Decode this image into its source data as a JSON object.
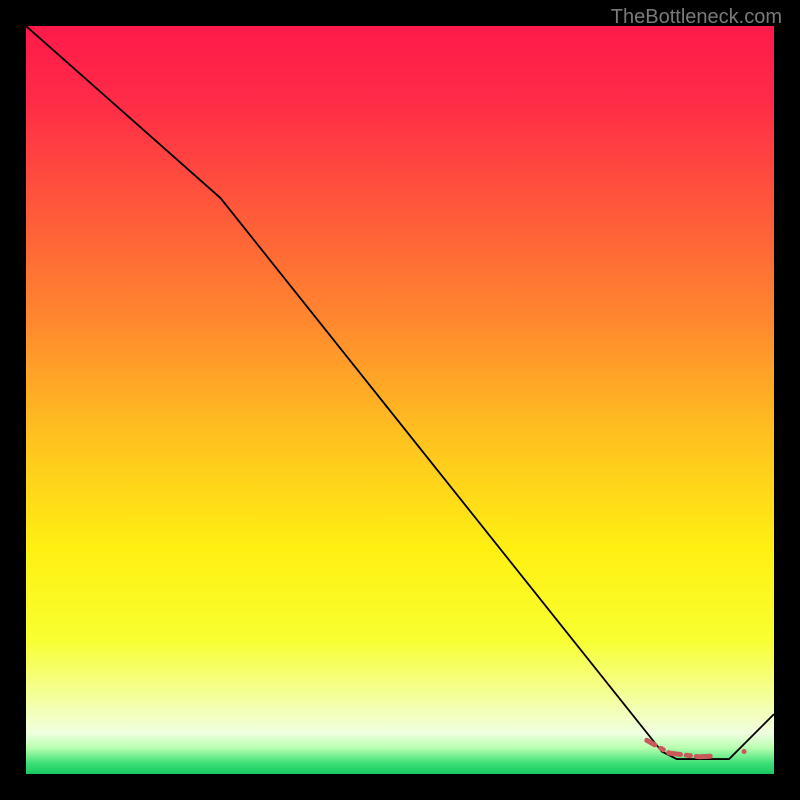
{
  "watermark": "TheBottleneck.com",
  "chart_data": {
    "type": "line",
    "x_range": [
      0,
      100
    ],
    "y_range": [
      0,
      100
    ],
    "series": [
      {
        "name": "curve",
        "color": "#000000",
        "width": 1.8,
        "points": [
          {
            "x": 0,
            "y": 100
          },
          {
            "x": 26,
            "y": 77
          },
          {
            "x": 85,
            "y": 3
          },
          {
            "x": 87,
            "y": 2
          },
          {
            "x": 94,
            "y": 2
          },
          {
            "x": 100,
            "y": 8
          }
        ]
      },
      {
        "name": "highlight",
        "color": "#c85a5a",
        "width": 5,
        "dashed": true,
        "points": [
          {
            "x": 83,
            "y": 4.5
          },
          {
            "x": 86,
            "y": 2.8
          },
          {
            "x": 90,
            "y": 2.3
          },
          {
            "x": 94,
            "y": 2.5
          },
          {
            "x": 96,
            "y": 3.0
          }
        ]
      }
    ],
    "gradient_stops": [
      {
        "offset": 0,
        "color": "#ff1a4a"
      },
      {
        "offset": 0.1,
        "color": "#ff2b47"
      },
      {
        "offset": 0.25,
        "color": "#ff5a3a"
      },
      {
        "offset": 0.4,
        "color": "#ff8a2e"
      },
      {
        "offset": 0.55,
        "color": "#ffc21f"
      },
      {
        "offset": 0.7,
        "color": "#fff012"
      },
      {
        "offset": 0.82,
        "color": "#f8ff30"
      },
      {
        "offset": 0.9,
        "color": "#f4ffa0"
      },
      {
        "offset": 0.945,
        "color": "#f0ffe0"
      },
      {
        "offset": 0.965,
        "color": "#b8ffb0"
      },
      {
        "offset": 0.985,
        "color": "#40e078"
      },
      {
        "offset": 1.0,
        "color": "#18c860"
      }
    ]
  }
}
